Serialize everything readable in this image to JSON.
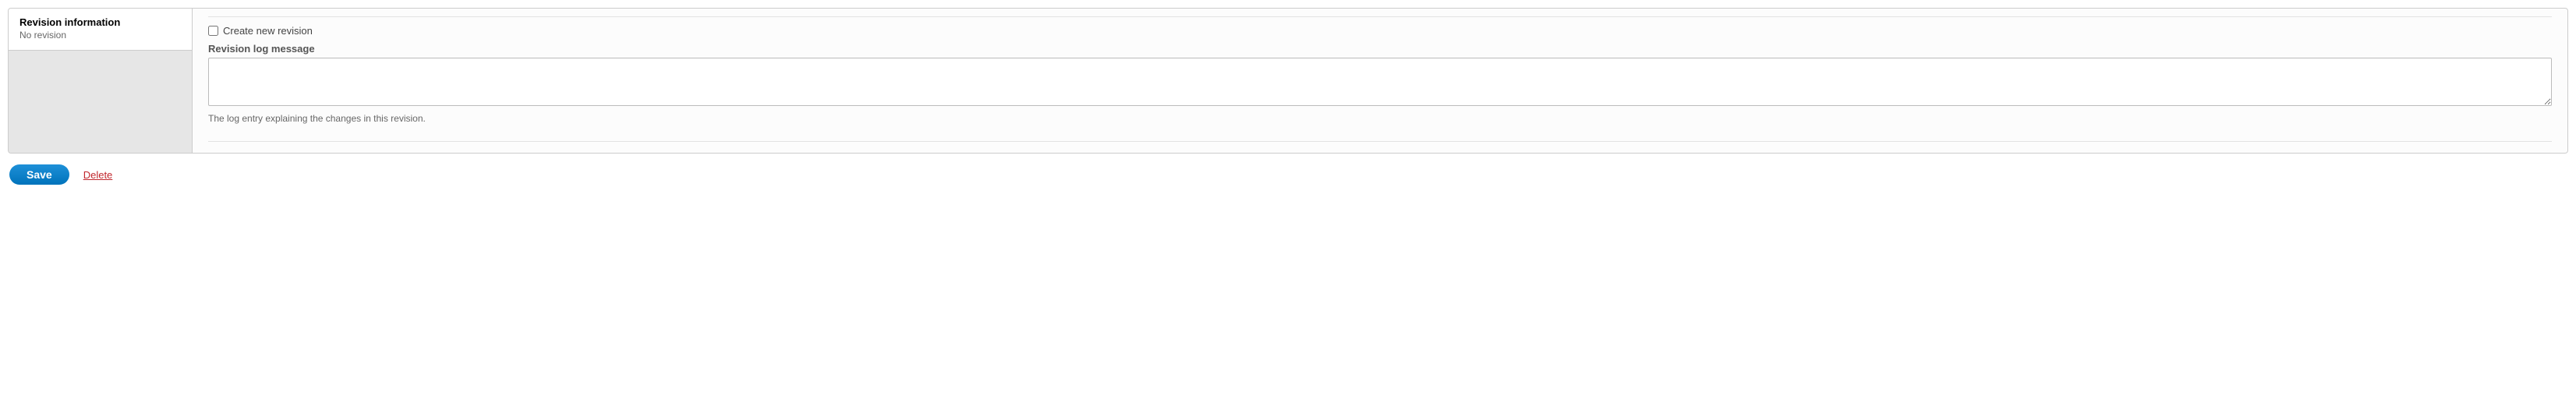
{
  "tabs": {
    "revision": {
      "title": "Revision information",
      "summary": "No revision"
    }
  },
  "pane": {
    "checkbox_label": "Create new revision",
    "log_label": "Revision log message",
    "log_value": "",
    "log_description": "The log entry explaining the changes in this revision."
  },
  "actions": {
    "save": "Save",
    "delete": "Delete"
  }
}
